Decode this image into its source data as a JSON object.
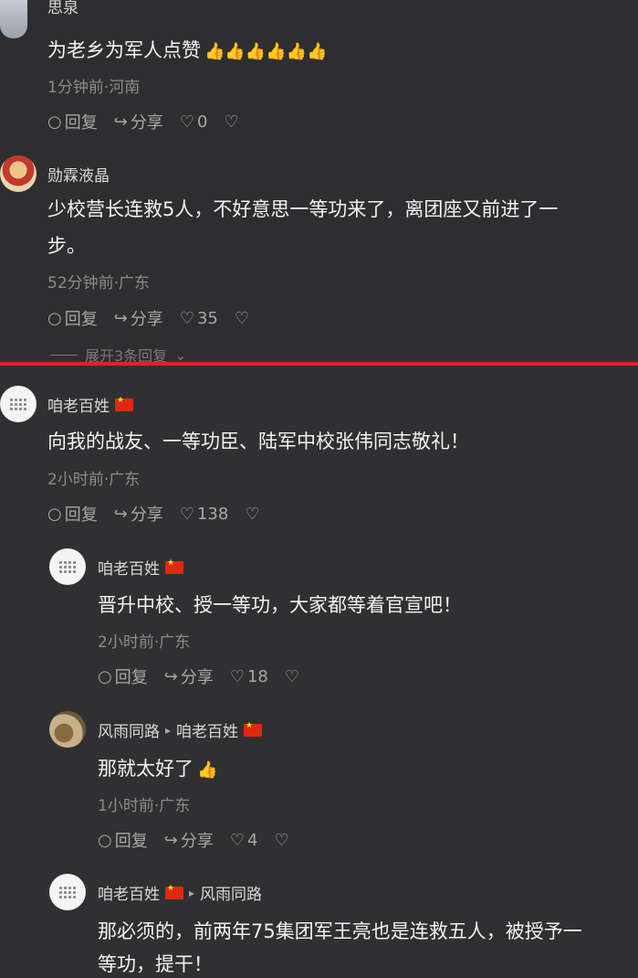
{
  "comments": [
    {
      "user": "思泉",
      "text": "为老乡为军人点赞",
      "emoji": "👍👍👍👍👍👍",
      "meta": "1分钟前·河南",
      "reply": "回复",
      "share": "分享",
      "likes": "0"
    },
    {
      "user": "勋霖液晶",
      "text_line1": "少校营长连救5人，不好意思一等功来了，离团座又前进了一",
      "text_line2": "步。",
      "meta": "52分钟前·广东",
      "reply": "回复",
      "share": "分享",
      "likes": "35",
      "expand": "展开3条回复"
    },
    {
      "user": "咱老百姓",
      "text": "向我的战友、一等功臣、陆军中校张伟同志敬礼！",
      "meta": "2小时前·广东",
      "reply": "回复",
      "share": "分享",
      "likes": "138"
    },
    {
      "user": "咱老百姓",
      "text": "晋升中校、授一等功，大家都等着官宣吧！",
      "meta": "2小时前·广东",
      "reply": "回复",
      "share": "分享",
      "likes": "18"
    },
    {
      "user": "风雨同路",
      "reply_to": "咱老百姓",
      "text": "那就太好了",
      "emoji": "👍",
      "meta": "1小时前·广东",
      "reply": "回复",
      "share": "分享",
      "likes": "4"
    },
    {
      "user": "咱老百姓",
      "reply_to": "风雨同路",
      "text_line1": "那必须的，前两年75集团军王亮也是连救五人，被授予一",
      "text_line2": "等功，提干！"
    }
  ],
  "icons": {
    "reply": "comment-bubble-icon",
    "share": "share-arrow-icon",
    "like": "heart-icon",
    "dislike": "broken-heart-icon"
  },
  "colors": {
    "divider": "#d6262a",
    "flag": "#de2910"
  }
}
